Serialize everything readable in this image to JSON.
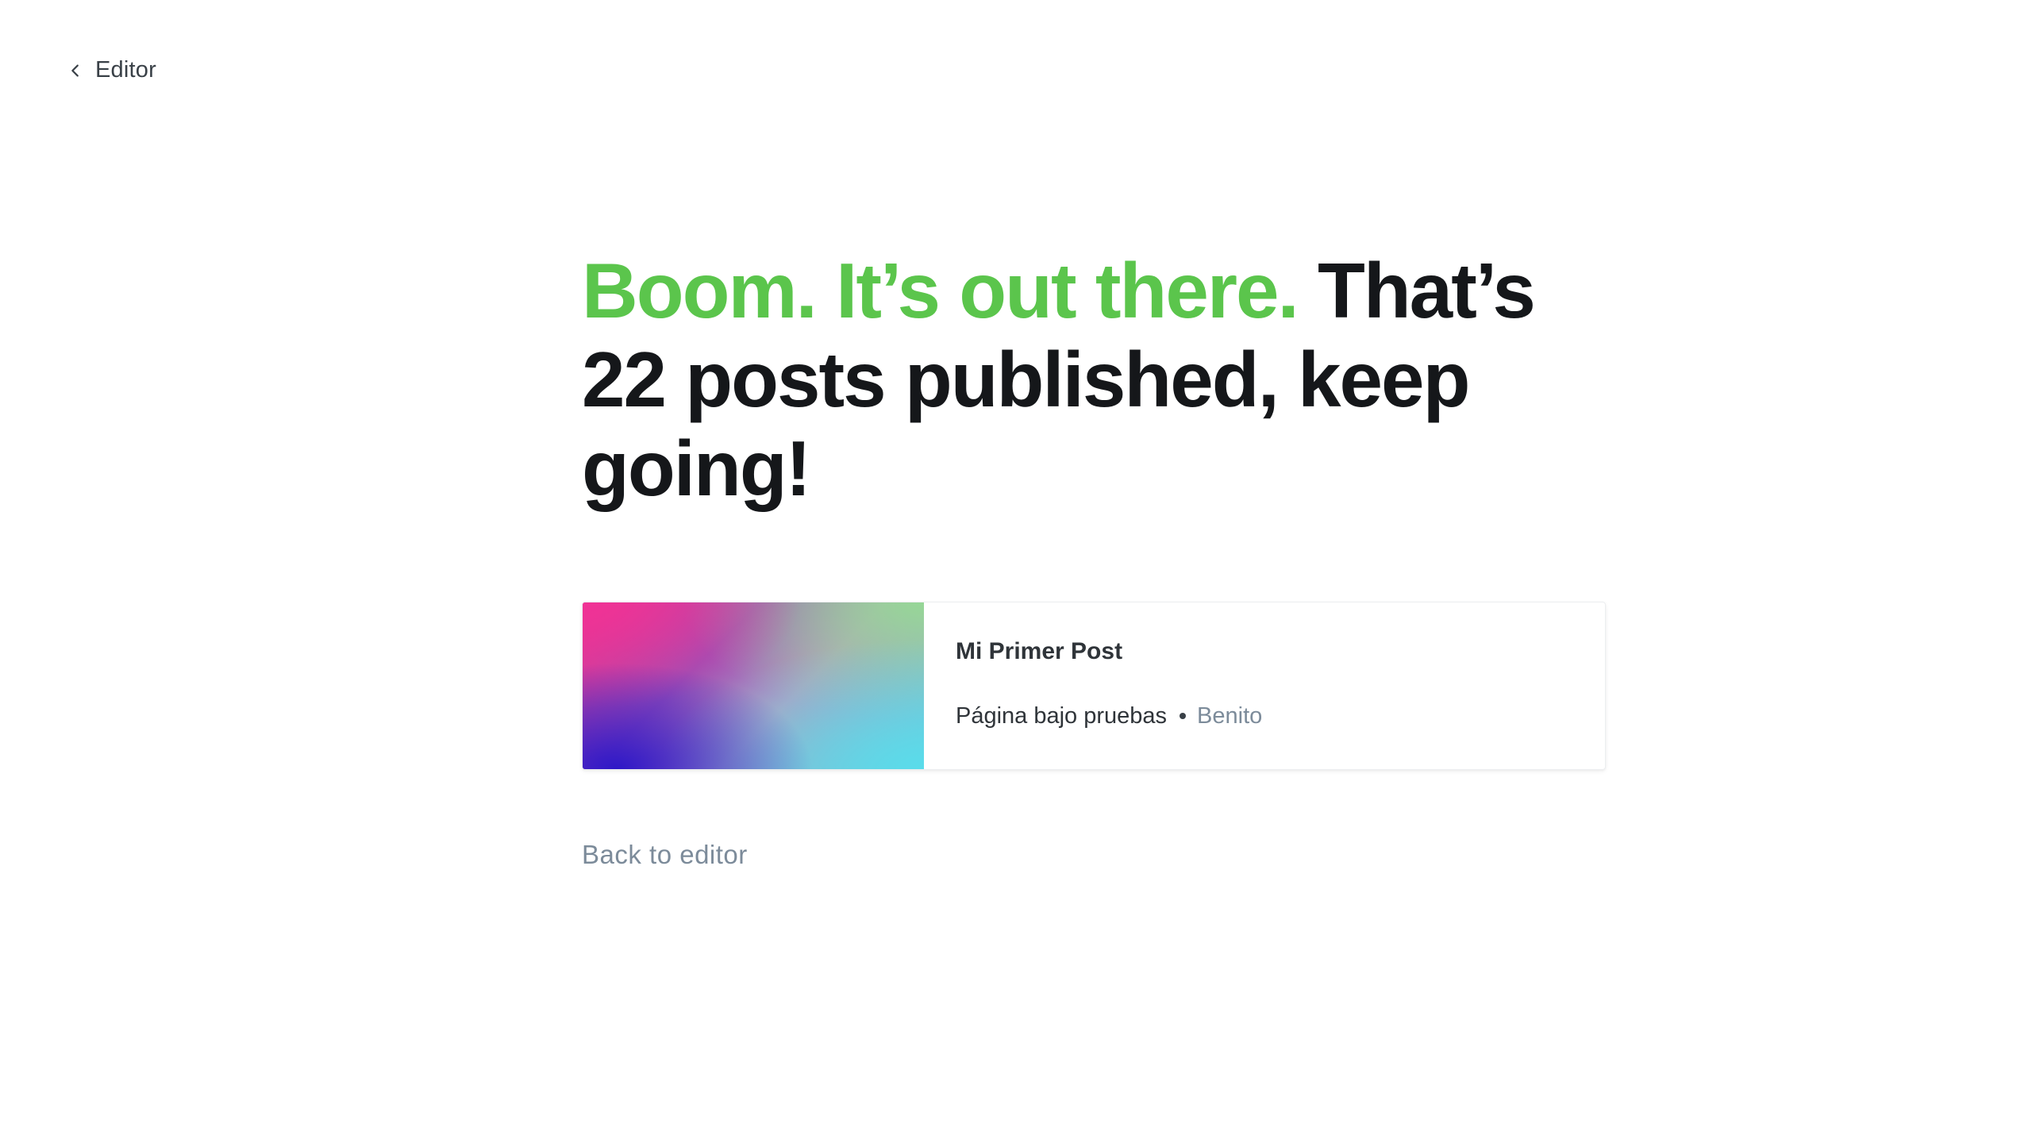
{
  "nav": {
    "back_label": "Editor",
    "back_icon": "chevron-left-icon"
  },
  "headline": {
    "accent_text": "Boom. It’s out there.",
    "main_text": " That’s 22 posts published, keep going!",
    "accent_color": "#5bc54c"
  },
  "post_card": {
    "title": "Mi Primer Post",
    "site": "Página bajo pruebas",
    "separator": "•",
    "author": "Benito"
  },
  "footer": {
    "back_to_editor": "Back to editor"
  }
}
